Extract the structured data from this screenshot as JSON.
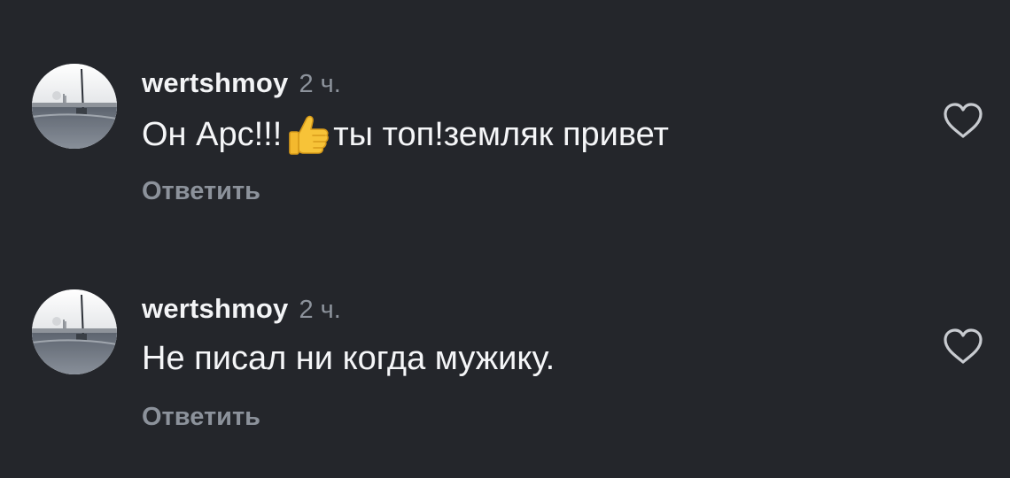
{
  "comments": [
    {
      "username": "wertshmoy",
      "time": "2 ч.",
      "text_before": "Он Арс!!!",
      "emoji": "thumbs-up",
      "text_after": "ты топ!земляк привет",
      "reply_label": "Ответить"
    },
    {
      "username": "wertshmoy",
      "time": "2 ч.",
      "text": "Не писал ни когда мужику.",
      "reply_label": "Ответить"
    }
  ],
  "icons": {
    "like": "heart-outline-icon",
    "reaction": "thumbs-up-icon"
  },
  "colors": {
    "background": "#24262b",
    "primary_text": "#f5f6f8",
    "secondary_text": "#8c929b",
    "icon_outline": "#c8cbd0"
  }
}
